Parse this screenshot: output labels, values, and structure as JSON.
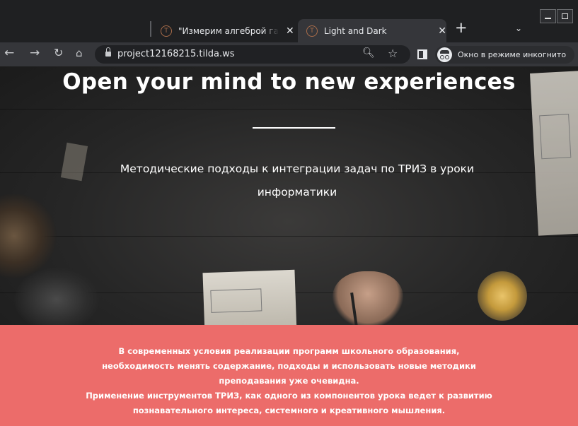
{
  "browser": {
    "tabs": [
      {
        "title": "\"Измерим алгеброй гармонию\"",
        "active": false
      },
      {
        "title": "Light and Dark",
        "active": true
      }
    ],
    "new_tab_label": "+",
    "tab_search_label": "⌄",
    "address": "project12168215.tilda.ws",
    "incognito_label": "Окно в режиме инкогнито"
  },
  "page": {
    "hero": {
      "title": "Open your mind to new experiences",
      "subtitle_line1": "Методические подходы к интеграции задач по ТРИЗ в уроки",
      "subtitle_line2": "информатики"
    },
    "info": {
      "lines": [
        "В современных условия реализации программ школьного образования,",
        "необходимость менять содержание, подходы и использовать новые методики",
        "преподавания уже очевидна.",
        "Применение инструментов ТРИЗ, как одного из компонентов урока ведет к развитию",
        "познавательного интереса, системного и креативного мышления."
      ]
    }
  },
  "colors": {
    "tabbar_bg": "#1f2022",
    "toolbar_bg": "#35363a",
    "info_bg": "#ec6c6a",
    "text_white": "#ffffff"
  }
}
